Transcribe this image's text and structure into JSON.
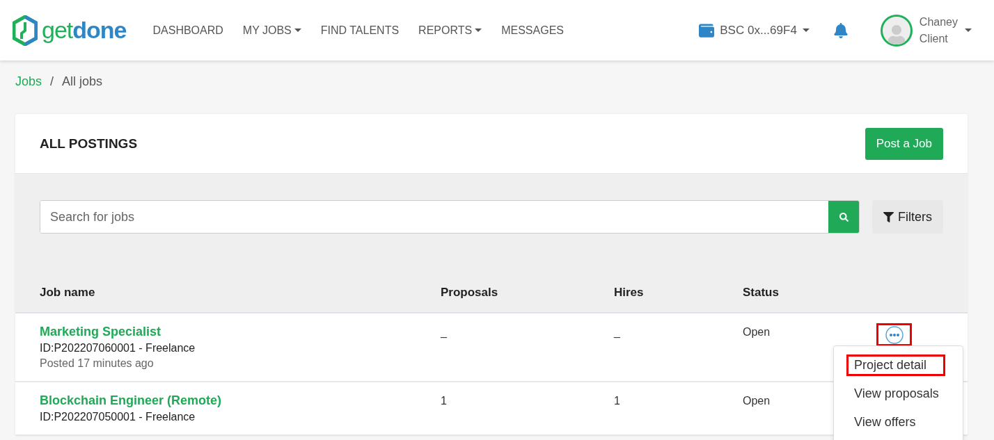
{
  "brand": {
    "part_1": "get",
    "part_2": "done"
  },
  "nav": [
    {
      "label": "DASHBOARD",
      "dropdown": false
    },
    {
      "label": "MY JOBS",
      "dropdown": true
    },
    {
      "label": "FIND TALENTS",
      "dropdown": false
    },
    {
      "label": "REPORTS",
      "dropdown": true
    },
    {
      "label": "MESSAGES",
      "dropdown": false
    }
  ],
  "wallet": {
    "label": "BSC 0x...69F4"
  },
  "user": {
    "name": "Chaney",
    "role": "Client"
  },
  "breadcrumb": {
    "separator": "/",
    "items": [
      {
        "label": "Jobs",
        "link": true
      },
      {
        "label": "All jobs",
        "link": false
      }
    ]
  },
  "card": {
    "title": "ALL POSTINGS",
    "post_button": "Post a Job"
  },
  "search": {
    "placeholder": "Search for jobs"
  },
  "filters_button": "Filters",
  "table": {
    "columns": [
      "Job name",
      "Proposals",
      "Hires",
      "Status"
    ],
    "rows": [
      {
        "name": "Marketing Specialist",
        "id": "ID:P202207060001 - Freelance",
        "posted": "Posted 17 minutes ago",
        "proposals": "_",
        "hires": "_",
        "status": "Open",
        "actions": {
          "highlighted": true
        }
      },
      {
        "name": "Blockchain Engineer (Remote)",
        "id": "ID:P202207050001 - Freelance",
        "proposals": "1",
        "hires": "1",
        "status": "Open"
      }
    ]
  },
  "row_menu": [
    {
      "label": "Project detail",
      "highlighted": true
    },
    {
      "label": "View proposals",
      "highlighted": false
    },
    {
      "label": "View offers",
      "highlighted": false
    }
  ]
}
